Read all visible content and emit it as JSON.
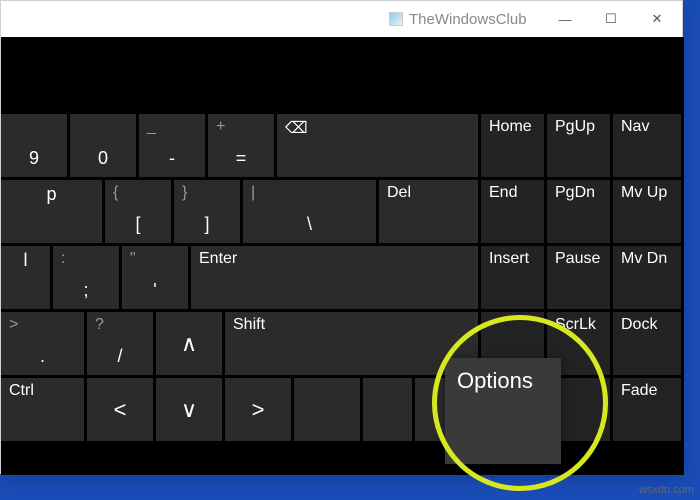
{
  "window": {
    "title": "TheWindowsClub",
    "minimize": "—",
    "maximize": "☐",
    "close": "✕"
  },
  "keys": {
    "r1": {
      "k9": "9",
      "k0": "0",
      "minus_s": "_",
      "minus": "-",
      "equals_s": "+",
      "equals": "=",
      "bksp": "⌫"
    },
    "r2": {
      "p": "p",
      "lbrack_s": "{",
      "lbrack": "[",
      "rbrack_s": "}",
      "rbrack": "]",
      "bslash_s": "|",
      "bslash": "\\",
      "del": "Del"
    },
    "r3": {
      "l": "l",
      "semi_s": ":",
      "semi": ";",
      "quote_s": "\"",
      "quote": "'",
      "enter": "Enter"
    },
    "r4": {
      "period_s": ">",
      "period": ".",
      "slash_s": "?",
      "slash": "/",
      "up": "∧",
      "shift": "Shift"
    },
    "r5": {
      "ctrl": "Ctrl",
      "left": "<",
      "down": "∨",
      "right": ">"
    },
    "nav": {
      "home": "Home",
      "pgup": "PgUp",
      "nav": "Nav",
      "end": "End",
      "pgdn": "PgDn",
      "mvup": "Mv Up",
      "insert": "Insert",
      "pause": "Pause",
      "mvdn": "Mv Dn",
      "prtscn": "",
      "scrlk": "ScrLk",
      "dock": "Dock",
      "fade": "Fade"
    }
  },
  "popup": {
    "options": "Options"
  },
  "watermark": "wsxdn.com"
}
